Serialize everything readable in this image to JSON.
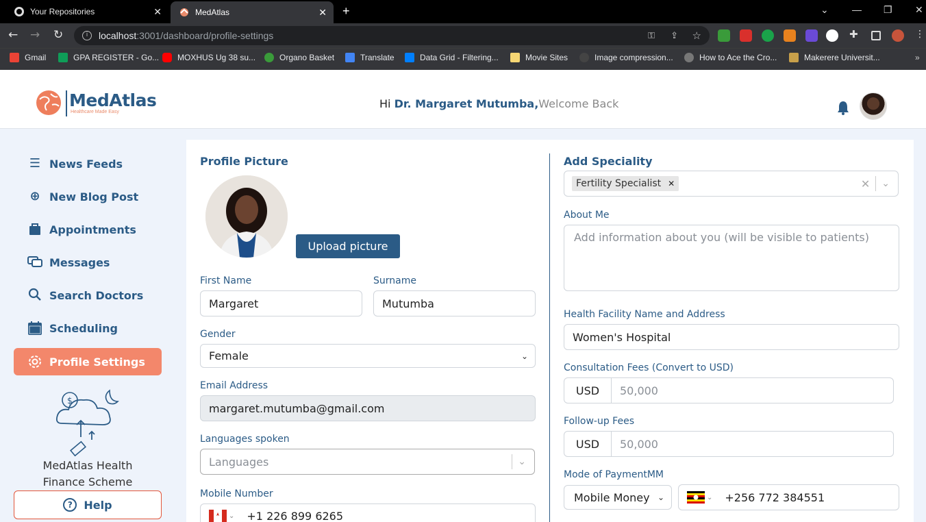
{
  "browser": {
    "tabs": [
      {
        "title": "Your Repositories",
        "active": false
      },
      {
        "title": "MedAtlas",
        "active": true
      }
    ],
    "url_host": "localhost",
    "url_rest": ":3001/dashboard/profile-settings",
    "bookmarks": [
      {
        "label": "Gmail",
        "icon": "gmail-icon",
        "color": "#ea4335"
      },
      {
        "label": "GPA REGISTER - Go...",
        "icon": "sheets-icon",
        "color": "#0f9d58"
      },
      {
        "label": "MOXHUS Ug 38 su...",
        "icon": "youtube-icon",
        "color": "#ff0000"
      },
      {
        "label": "Organo Basket",
        "icon": "organo-icon",
        "color": "#3a9b3a"
      },
      {
        "label": "Translate",
        "icon": "translate-icon",
        "color": "#4285f4"
      },
      {
        "label": "Data Grid - Filtering...",
        "icon": "mui-icon",
        "color": "#007fff"
      },
      {
        "label": "Movie Sites",
        "icon": "folder-icon",
        "color": "#f7d774"
      },
      {
        "label": "Image compression...",
        "icon": "github-icon",
        "color": "#444"
      },
      {
        "label": "How to Ace the Cro...",
        "icon": "link-icon",
        "color": "#777"
      },
      {
        "label": "Makerere Universit...",
        "icon": "makerere-icon",
        "color": "#c8a04a"
      }
    ]
  },
  "app": {
    "brand": "MedAtlas",
    "tagline": "Healthcare Made Easy",
    "greeting_prefix": "Hi ",
    "greeting_name": "Dr. Margaret Mutumba,",
    "greeting_suffix": "Welcome Back"
  },
  "sidebar": {
    "items": [
      {
        "label": "News Feeds",
        "icon": "menu-icon",
        "active": false
      },
      {
        "label": "New Blog Post",
        "icon": "plus-circle-icon",
        "active": false
      },
      {
        "label": "Appointments",
        "icon": "bag-icon",
        "active": false
      },
      {
        "label": "Messages",
        "icon": "chat-icon",
        "active": false
      },
      {
        "label": "Search Doctors",
        "icon": "search-icon",
        "active": false
      },
      {
        "label": "Scheduling",
        "icon": "calendar-icon",
        "active": false
      },
      {
        "label": "Profile Settings",
        "icon": "gear-icon",
        "active": true
      }
    ],
    "promo_text": "MedAtlas Health Finance Scheme",
    "help_label": "Help"
  },
  "form": {
    "profile_picture_title": "Profile Picture",
    "upload_label": "Upload picture",
    "first_name_label": "First Name",
    "first_name_value": "Margaret",
    "surname_label": "Surname",
    "surname_value": "Mutumba",
    "gender_label": "Gender",
    "gender_value": "Female",
    "email_label": "Email Address",
    "email_value": "margaret.mutumba@gmail.com",
    "languages_label": "Languages spoken",
    "languages_placeholder": "Languages",
    "mobile_label": "Mobile Number",
    "mobile_value": "+1 226 899 6265",
    "speciality_title": "Add Speciality",
    "speciality_tag": "Fertility Specialist",
    "about_label": "About Me",
    "about_placeholder": "Add information about you (will be visible to patients)",
    "facility_label": "Health Facility Name and Address",
    "facility_value": "Women's Hospital",
    "consult_label": "Consultation Fees (Convert to USD)",
    "consult_currency": "USD",
    "consult_placeholder": "50,000",
    "followup_label": "Follow-up Fees",
    "followup_currency": "USD",
    "followup_placeholder": "50,000",
    "payment_label": "Mode of PaymentMM",
    "payment_value": "Mobile Money",
    "payment_phone": "+256 772 384551"
  },
  "colors": {
    "brand": "#2b5b86",
    "accent": "#f3876b"
  }
}
